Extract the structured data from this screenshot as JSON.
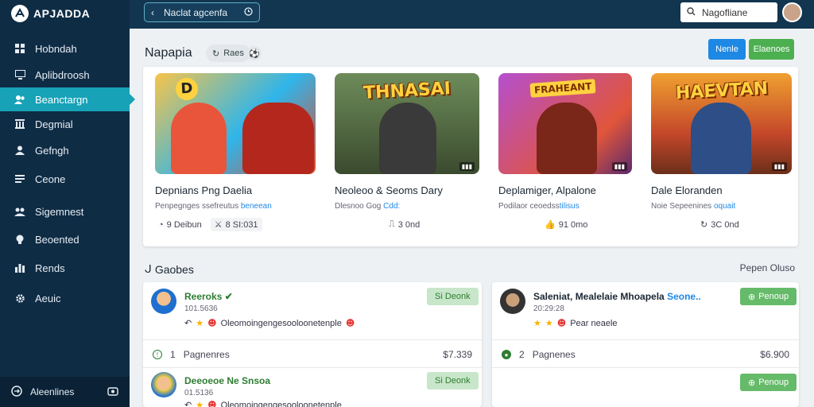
{
  "app": {
    "logo_text": "APJADDA"
  },
  "sidebar": {
    "items": [
      {
        "label": "Hobndah",
        "icon": "grid-icon"
      },
      {
        "label": "Aplibdroosh",
        "icon": "monitor-icon"
      },
      {
        "label": "Beanctargn",
        "icon": "users-icon",
        "active": true
      },
      {
        "label": "Degmial",
        "icon": "bank-icon"
      },
      {
        "label": "Gefngh",
        "icon": "user-icon"
      },
      {
        "label": "Ceone",
        "icon": "list-icon"
      },
      {
        "label": "Sigemnest",
        "icon": "group-icon"
      },
      {
        "label": "Beoented",
        "icon": "bulb-icon"
      },
      {
        "label": "Rends",
        "icon": "bars-icon"
      },
      {
        "label": "Aeuic",
        "icon": "gear-icon"
      }
    ],
    "bottom_label": "Aleenlines"
  },
  "topbar": {
    "back_label": "Naclat agcenfa",
    "search_value": "Nagofliane"
  },
  "header": {
    "title": "Napapia",
    "chip_label": "Raes",
    "btn_primary": "Nenle",
    "btn_success": "Elaenoes"
  },
  "games": [
    {
      "banner": "D",
      "title": "Depnians Png Daelia",
      "sub_plain": "Penpegnges ssefreutus ",
      "sub_hl": "beneean",
      "stat1": "9 Deibun",
      "stat2": "8 SI:031",
      "colors": [
        "#ffb547",
        "#2bb2e8",
        "#e24c2b"
      ]
    },
    {
      "banner": "THNASAI",
      "title": "Neoleoo & Seoms Dary",
      "sub_plain": "Dlesnoo Gog ",
      "sub_hl": "Cdd:",
      "stat1": "",
      "stat2": "3 0nd",
      "colors": [
        "#4b6b3a",
        "#7a8c5a",
        "#2b3a2a"
      ]
    },
    {
      "banner": "FRAHEANT",
      "title": "Deplamiger, Alpalone",
      "sub_plain": "Podilaor ceoedss",
      "sub_hl": "tilisus",
      "stat1": "",
      "stat2": "91 0mo",
      "colors": [
        "#a23fb0",
        "#e0553a",
        "#5a2a6e"
      ]
    },
    {
      "banner": "HAEVTAN",
      "title": "Dale Eloranden",
      "sub_plain": "Noie Sepeenines ",
      "sub_hl": "oquait",
      "stat1": "",
      "stat2": "3C 0nd",
      "colors": [
        "#e08a2a",
        "#c4472a",
        "#6b2f1a"
      ]
    }
  ],
  "section": {
    "title": "Gaobes",
    "link": "Pepen Oluso"
  },
  "players": [
    {
      "name": "Reeroks",
      "verified": "✔",
      "meta": "101.5636",
      "react": "Oleomoingengesooloonetenple",
      "btn": "Si Deonk",
      "foot": "Pagnenres",
      "count": "1",
      "price": "$7.339"
    },
    {
      "name_plain": "Saleniat, Mealelaie Mhoapela ",
      "name_hl": "Seone..",
      "meta": "20:29:28",
      "react": "Pear neaele",
      "btn": "Penoup",
      "foot": "Pagnenes",
      "count": "2",
      "price": "$6.900"
    },
    {
      "name": "Deeoeoe Ne Snsoa",
      "meta": "01.5136",
      "react": "Oleomoingengesooloonetenple",
      "btn": "Si Deonk"
    },
    {
      "btn": "Penoup"
    }
  ]
}
